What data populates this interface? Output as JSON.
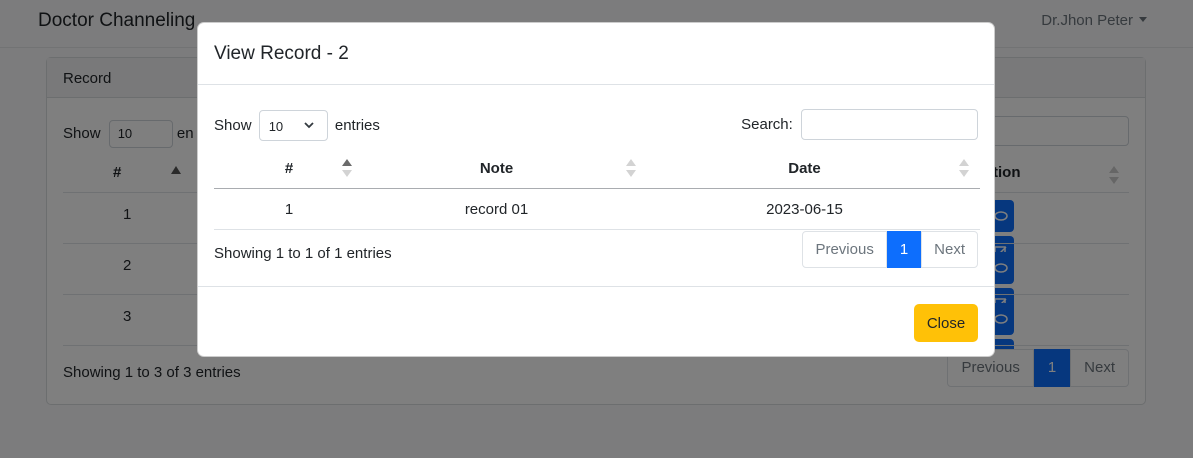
{
  "navbar": {
    "brand": "Doctor Channeling",
    "user_name": "Dr.Jhon Peter"
  },
  "background": {
    "card_title": "Record",
    "show_label": "Show",
    "entries_value": "10",
    "entries_label_partial": "en",
    "columns": {
      "num": "#",
      "action_partial": "tion"
    },
    "rows": [
      "1",
      "2",
      "3"
    ],
    "info": "Showing 1 to 3 of 3 entries",
    "pagination": {
      "previous": "Previous",
      "page": "1",
      "next": "Next"
    }
  },
  "modal": {
    "title": "View Record - 2",
    "show_label": "Show",
    "entries_value": "10",
    "entries_label": "entries",
    "search_label": "Search:",
    "search_value": "",
    "columns": {
      "num": "#",
      "note": "Note",
      "date": "Date"
    },
    "rows": [
      {
        "num": "1",
        "note": "record 01",
        "date": "2023-06-15"
      }
    ],
    "info": "Showing 1 to 1 of 1 entries",
    "pagination": {
      "previous": "Previous",
      "page": "1",
      "next": "Next"
    },
    "close_label": "Close"
  },
  "colors": {
    "primary": "#0d6efd",
    "warning": "#ffc107",
    "backdrop": "rgba(0,0,0,0.5)"
  },
  "icons": [
    "chevron-down-icon",
    "sort-asc-icon",
    "sort-both-icon",
    "edit-icon",
    "eye-icon",
    "caret-down-icon"
  ]
}
